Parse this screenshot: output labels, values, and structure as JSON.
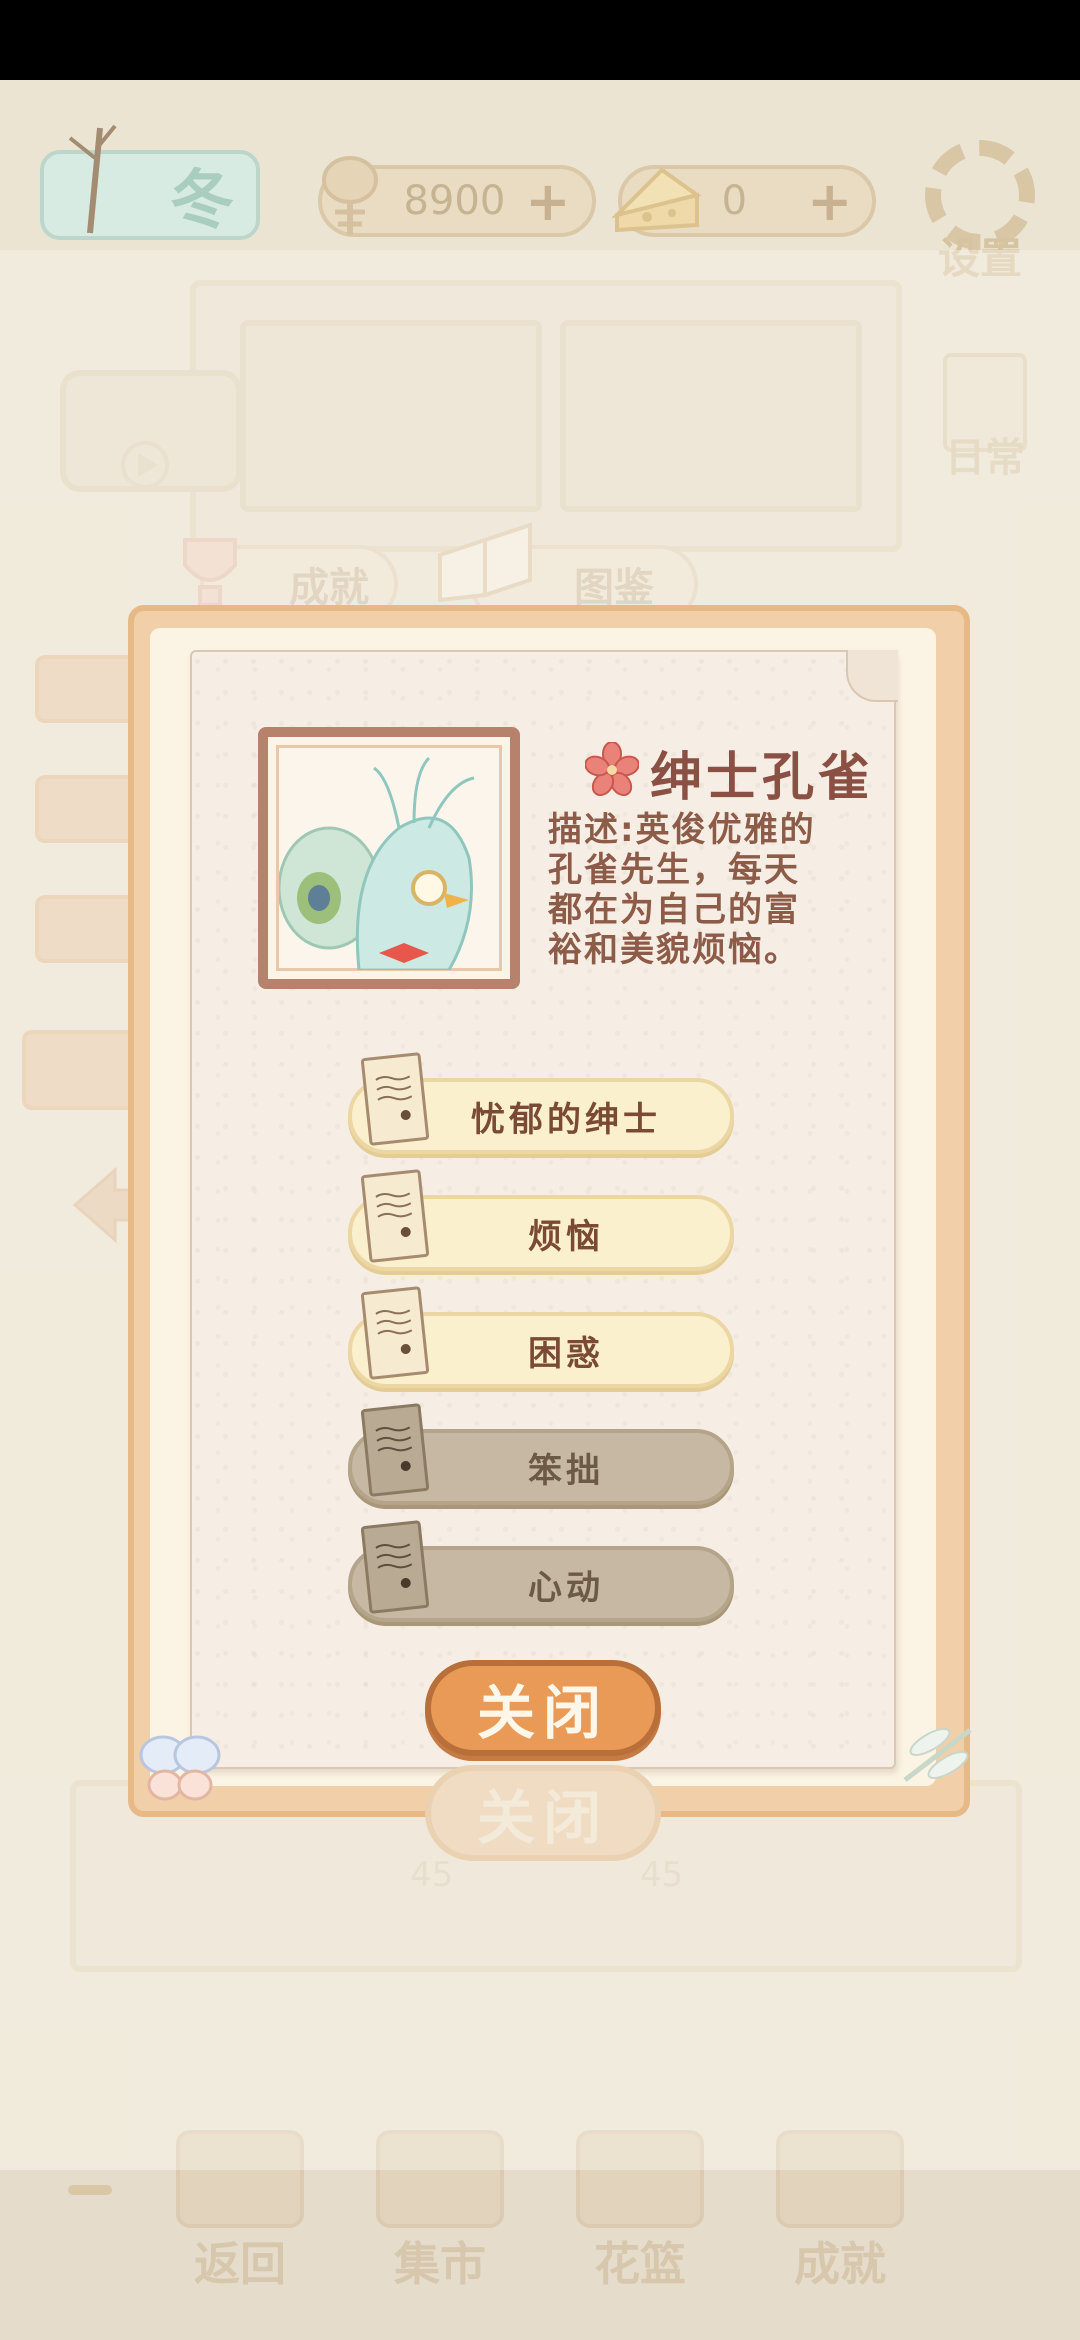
{
  "status_bar": {},
  "top_bar": {
    "season": "冬",
    "fish_count": "8900",
    "cheese_count": "0",
    "settings_label": "设置"
  },
  "side_menu": {
    "daily_label": "日常"
  },
  "tabs": {
    "achievement": "成就",
    "collection": "图鉴"
  },
  "shelf_numbers": [
    "45",
    "45"
  ],
  "character": {
    "name": "绅士孔雀",
    "description": "描述:英俊优雅的\n孔雀先生，每天\n都在为自己的富\n裕和美貌烦恼。"
  },
  "stories": [
    {
      "label": "忧郁的绅士",
      "unlocked": true
    },
    {
      "label": "烦恼",
      "unlocked": true
    },
    {
      "label": "困惑",
      "unlocked": true
    },
    {
      "label": "笨拙",
      "unlocked": false
    },
    {
      "label": "心动",
      "unlocked": false
    }
  ],
  "close_label": "关闭",
  "bottom_nav": [
    {
      "label": "返回",
      "icon": "return-icon"
    },
    {
      "label": "集市",
      "icon": "market-icon"
    },
    {
      "label": "花篮",
      "icon": "flower-basket-icon"
    },
    {
      "label": "成就",
      "icon": "achievement-icon"
    }
  ],
  "colors": {
    "accent": "#e99a57",
    "title": "#8a5043",
    "unlocked": "#fbf0cd",
    "locked": "#c6b8a2"
  }
}
